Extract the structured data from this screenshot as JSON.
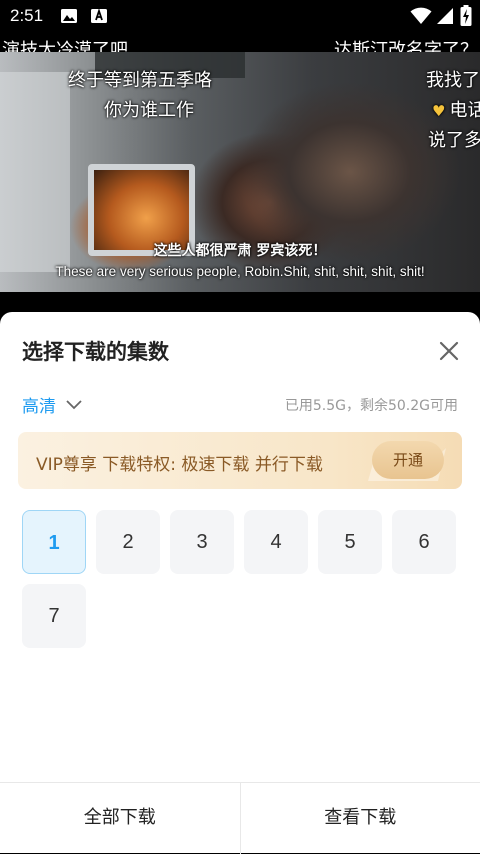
{
  "status_bar": {
    "time": "2:51",
    "icons": [
      "image-icon",
      "font-app-icon",
      "wifi-icon",
      "signal-icon",
      "battery-charging-icon"
    ]
  },
  "video": {
    "subtitle_cn": "这些人都很严肃 罗宾该死！",
    "subtitle_en": "These are very serious people, Robin.Shit, shit, shit, shit, shit!",
    "danmaku": [
      "演技太冷漠了吧",
      "达斯汀改名字了？",
      "终于等到第五季咯",
      "我找了",
      "你为谁工作",
      "电话",
      "说了多"
    ]
  },
  "sheet": {
    "title": "选择下载的集数",
    "close_icon": "close-icon",
    "quality_label": "高清",
    "storage_info": "已用5.5G，剩余50.2G可用",
    "vip_banner": {
      "text": "VIP尊享 下载特权: 极速下载 并行下载",
      "button_label": "开通"
    },
    "episodes": [
      "1",
      "2",
      "3",
      "4",
      "5",
      "6",
      "7"
    ],
    "selected_episode": "1",
    "download_all_label": "全部下载",
    "view_downloads_label": "查看下载"
  },
  "colors": {
    "accent": "#1e9bf0",
    "vip_text": "#8a5a26",
    "vip_button": "#e8c490"
  }
}
